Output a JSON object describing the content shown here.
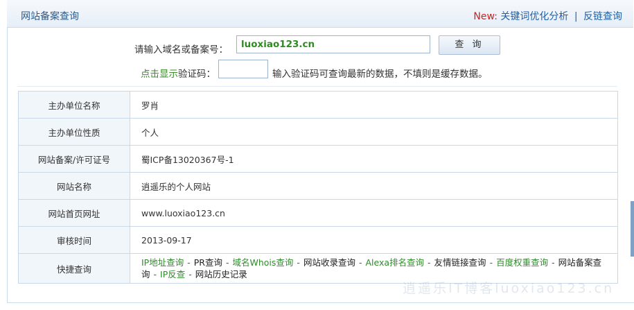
{
  "header": {
    "title": "网站备案查询",
    "new_tag": "New:",
    "link_keyword": "关键词优化分析",
    "separator": "|",
    "link_backlink": "反链查询"
  },
  "search": {
    "domain_label": "请输入域名或备案号：",
    "domain_value": "luoxiao123.cn",
    "query_button": "查 询",
    "captcha_link": "点击显示",
    "captcha_label": "验证码：",
    "captcha_value": "",
    "captcha_hint": "输入验证码可查询最新的数据，不填则是缓存数据。"
  },
  "info": {
    "rows": [
      {
        "key": "主办单位名称",
        "value": "罗肖"
      },
      {
        "key": "主办单位性质",
        "value": "个人"
      },
      {
        "key": "网站备案/许可证号",
        "value": "蜀ICP备13020367号-1"
      },
      {
        "key": "网站名称",
        "value": "逍遥乐的个人网站"
      },
      {
        "key": "网站首页网址",
        "value": "www.luoxiao123.cn"
      },
      {
        "key": "审核时间",
        "value": "2013-09-17"
      }
    ],
    "quick_key": "快捷查询",
    "quick_links": [
      {
        "label": "IP地址查询",
        "style": "green"
      },
      {
        "label": "PR查询",
        "style": "dark"
      },
      {
        "label": "域名Whois查询",
        "style": "green"
      },
      {
        "label": "网站收录查询",
        "style": "dark"
      },
      {
        "label": "Alexa排名查询",
        "style": "green"
      },
      {
        "label": "友情链接查询",
        "style": "dark"
      },
      {
        "label": "百度权重查询",
        "style": "green"
      },
      {
        "label": "网站备案查询",
        "style": "dark"
      },
      {
        "label": "IP反查",
        "style": "green"
      },
      {
        "label": "网站历史记录",
        "style": "dark"
      }
    ]
  },
  "watermark": "逍遥乐IT博客luoxiao123.cn",
  "colors": {
    "header_title": "#2a5a8c",
    "new_tag": "#d0201a",
    "link_blue": "#1f5fa8",
    "link_green": "#2f8a2a",
    "input_value": "#2e8b1e",
    "key_cell_bg": "#f1f6fb",
    "border": "#c8d8e8"
  }
}
